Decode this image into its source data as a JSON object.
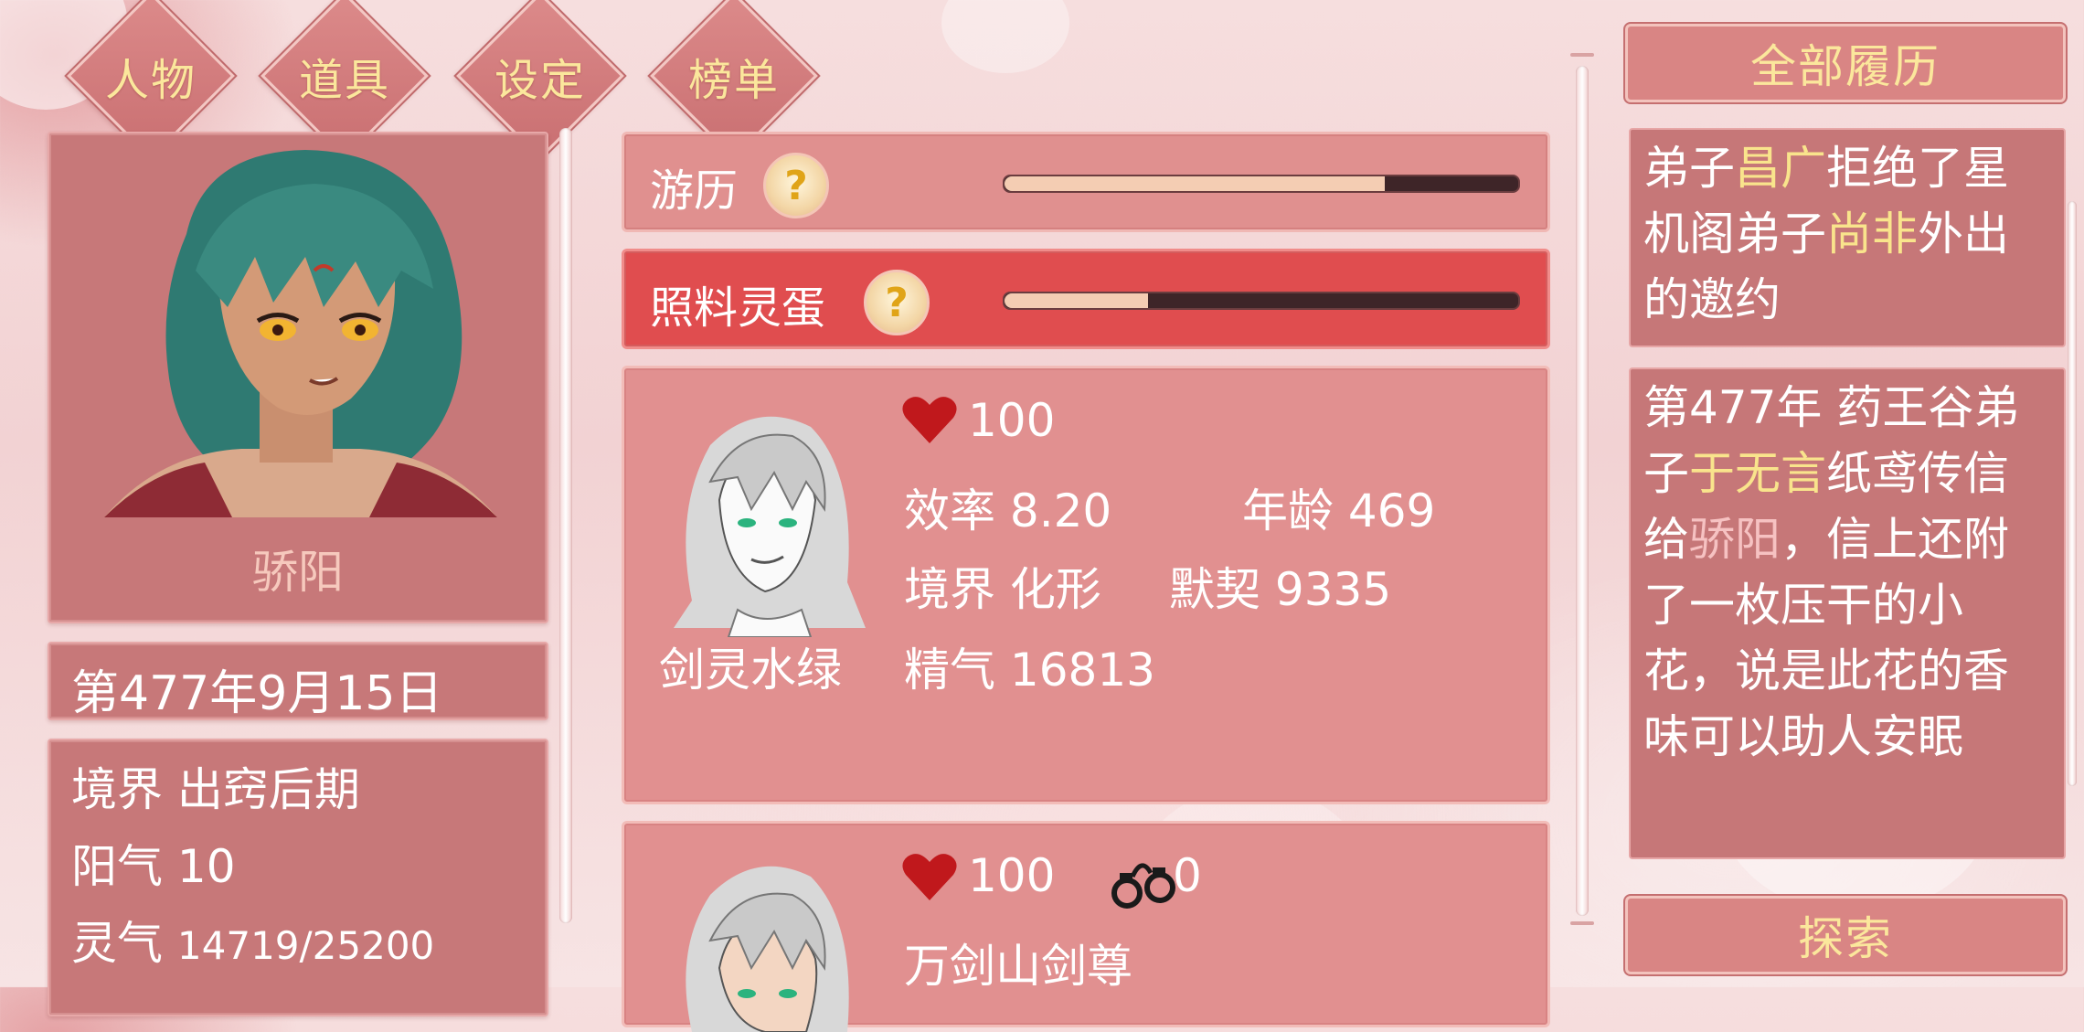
{
  "menu": [
    {
      "label": "人物"
    },
    {
      "label": "道具"
    },
    {
      "label": "设定"
    },
    {
      "label": "榜单"
    }
  ],
  "player": {
    "name": "骄阳",
    "date": "第477年9月15日",
    "realm": "境界 出窍后期",
    "yang": "阳气 10",
    "spirit_label": "灵气",
    "spirit_value": "14719/25200"
  },
  "tasks": [
    {
      "label": "游历",
      "progress": 0.74,
      "help": "?"
    },
    {
      "label": "照料灵蛋",
      "progress": 0.28,
      "help": "?"
    }
  ],
  "companions": [
    {
      "name": "剑灵水绿",
      "affection": "100",
      "efficiency": "效率 8.20",
      "age": "年龄 469",
      "realm": "境界 化形",
      "tacit": "默契 9335",
      "essence": "精气 16813"
    },
    {
      "affection": "100",
      "bond": "0",
      "title": "万剑山剑尊"
    }
  ],
  "right": {
    "history_button": "全部履历",
    "explore_button": "探索",
    "log1": {
      "t1": "弟子",
      "n1": "昌广",
      "t2": "拒绝了星机阁弟子",
      "n2": "尚非",
      "t3": "外出的邀约"
    },
    "log2": {
      "t1": "第477年 药王谷弟子",
      "n1": "于无言",
      "t2": "纸鸢传信给",
      "n2": "骄阳",
      "t3": "，信上还附了一枚压干的小花，说是此花的香味可以助人安眠"
    }
  },
  "colors": {
    "accent_gold": "#fbe79c",
    "panel": "#c77879",
    "active_task": "#e04d4f",
    "heart": "#c0181c"
  }
}
